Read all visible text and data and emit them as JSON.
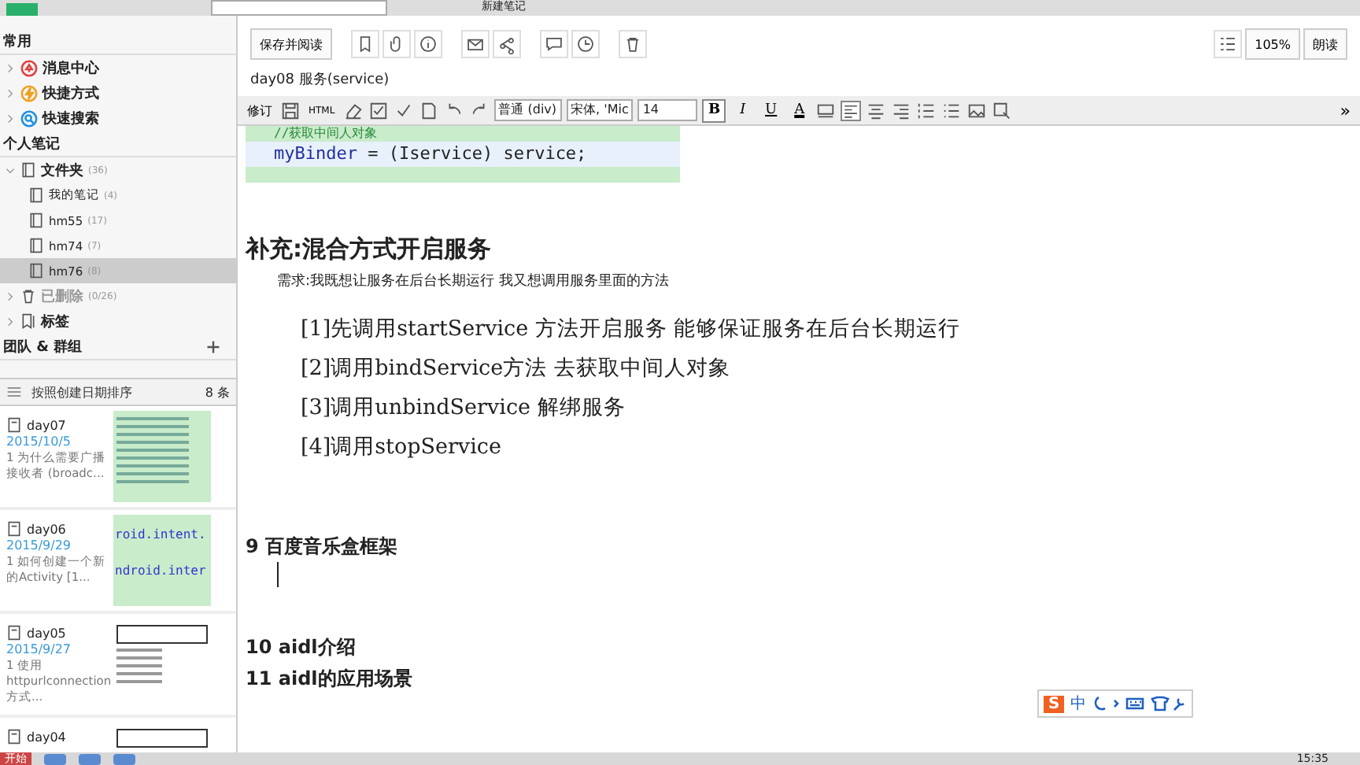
{
  "top_bar": {
    "new_note": "新建笔记"
  },
  "sidebar": {
    "sections": [
      {
        "title": "常用",
        "items": [
          {
            "label": "消息中心",
            "color": "#e04040"
          },
          {
            "label": "快捷方式",
            "color": "#f0a020"
          },
          {
            "label": "快速搜索",
            "color": "#2090e0"
          }
        ]
      },
      {
        "title": "个人笔记",
        "items": [
          {
            "label": "文件夹",
            "count": "(36)",
            "kind": "folder",
            "expanded": true,
            "selected": false,
            "children": [
              {
                "label": "我的笔记",
                "count": "(4)",
                "selected": false
              },
              {
                "label": "hm55",
                "count": "(17)",
                "selected": false
              },
              {
                "label": "hm74",
                "count": "(7)",
                "selected": false
              },
              {
                "label": "hm76",
                "count": "(8)",
                "selected": true
              }
            ]
          },
          {
            "label": "已删除",
            "count": "(0/26)",
            "kind": "trash",
            "expanded": false,
            "selected": false
          },
          {
            "label": "标签",
            "kind": "tag",
            "expanded": false,
            "selected": false
          }
        ]
      },
      {
        "title": "团队 & 群组"
      }
    ]
  },
  "note_list": {
    "sort": "按照创建日期排序",
    "count": "8 条",
    "notes": [
      {
        "title": "day07",
        "date": "2015/10/5",
        "snippet": "1 为什么需要广播接收者 (broadc...",
        "kind": "code"
      },
      {
        "title": "day06",
        "date": "2015/9/29",
        "snippet": "1 如何创建一个新的Activity [1...",
        "kind": "text",
        "thumb_lines": [
          "roid.intent.",
          "ndroid.inter"
        ]
      },
      {
        "title": "day05",
        "date": "2015/9/27",
        "snippet": "1 使用httpurlconnection 方式...",
        "kind": "table"
      },
      {
        "title": "day04",
        "kind": "sketch"
      }
    ]
  },
  "toolbar": {
    "save": "保存并阅读",
    "zoom": "105%",
    "read": "朗读"
  },
  "note_title": "day08 服务(service)",
  "format_bar": {
    "revise": "修订",
    "html": "HTML",
    "style": "普通 (div)",
    "font": "宋体, 'Mic",
    "size": "14",
    "text_buttons": [
      {
        "label": "B",
        "kind": "bold",
        "selected": true
      },
      {
        "label": "I",
        "kind": "italic",
        "selected": false
      },
      {
        "label": "U",
        "kind": "underline",
        "selected": false
      },
      {
        "label": "A",
        "kind": "color",
        "selected": false
      }
    ],
    "align_left": true,
    "more": "»"
  },
  "content": {
    "code": [
      {
        "kind": "comment",
        "text": "//获取中间人对象"
      },
      {
        "kind": "code",
        "var": "myBinder",
        "text": " = (Iservice) service;"
      }
    ],
    "heading": "补充:混合方式开启服务",
    "requirement": "需求:我既想让服务在后台长期运行 我又想调用服务里面的方法",
    "steps": [
      "[1]先调用startService 方法开启服务  能够保证服务在后台长期运行",
      "[2]调用bindService方法 去获取中间人对象",
      "[3]调用unbindService 解绑服务",
      "[4]调用stopService"
    ],
    "sections": [
      {
        "text": "9 百度音乐盒框架",
        "cursor": true
      },
      {
        "text": "10 aidl介绍",
        "cursor": false
      },
      {
        "text": "11 aidl的应用场景",
        "cursor": false
      }
    ]
  },
  "ime": {
    "logo": "S",
    "mode": "中"
  },
  "taskbar": {
    "start": "开始",
    "clock": "15:35"
  }
}
